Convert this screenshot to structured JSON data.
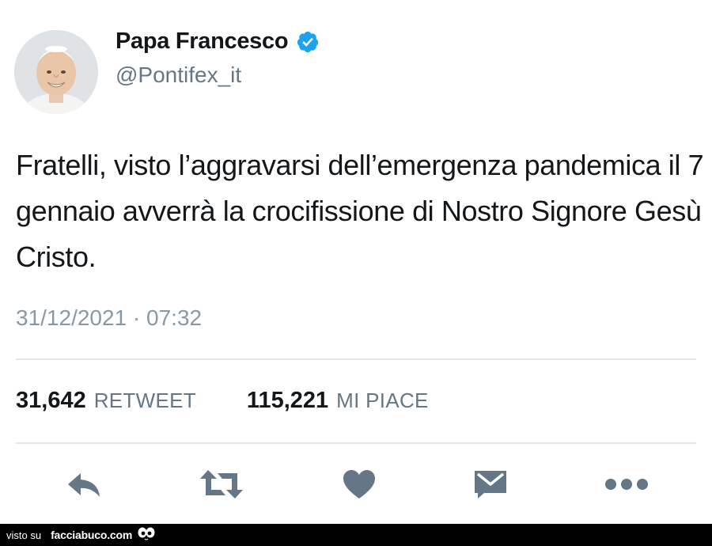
{
  "tweet": {
    "author": {
      "display_name": "Papa Francesco",
      "handle": "@Pontifex_it",
      "verified": true,
      "verified_icon": "verified-badge-icon",
      "avatar_icon": "avatar-photo"
    },
    "text": "Fratelli, visto l’aggravarsi dell’emergenza pandemica il 7 gennaio avverrà la crocifissione di Nostro Signore Gesù Cristo.",
    "timestamp": "31/12/2021 · 07:32",
    "stats": {
      "retweet_count": "31,642",
      "retweet_label": "RETWEET",
      "like_count": "115,221",
      "like_label": "MI PIACE"
    },
    "actions": [
      {
        "name": "reply",
        "icon": "reply-icon"
      },
      {
        "name": "retweet",
        "icon": "retweet-icon"
      },
      {
        "name": "like",
        "icon": "heart-icon"
      },
      {
        "name": "message",
        "icon": "envelope-icon"
      },
      {
        "name": "more",
        "icon": "more-dots-icon"
      }
    ]
  },
  "footer": {
    "prefix": "visto su",
    "site": "facciabuco.com",
    "logo_icon": "eyes-logo-icon"
  },
  "colors": {
    "text_primary": "#14171a",
    "text_secondary": "#657786",
    "timestamp": "#8899a6",
    "divider": "#e1e8ed",
    "verified": "#1da1f2",
    "action_icon": "#657786",
    "footer_bg": "#000000"
  }
}
